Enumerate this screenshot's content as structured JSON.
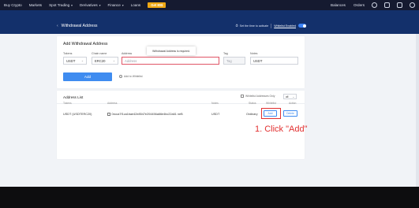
{
  "topnav": {
    "items": [
      {
        "label": "Buy Crypto",
        "caret": false
      },
      {
        "label": "Markets",
        "caret": false
      },
      {
        "label": "Spot Trading",
        "caret": true
      },
      {
        "label": "Derivatives",
        "caret": true
      },
      {
        "label": "Finance",
        "caret": true
      },
      {
        "label": "Loans",
        "caret": false
      }
    ],
    "badge": "Get 80$",
    "balances": "Balances",
    "orders": "Orders",
    "caret_glyph": "▾"
  },
  "subheader": {
    "back_glyph": "‹",
    "title": "Withdrawal Address",
    "time_link": "Set the time to activate",
    "whitelist_label": "Whitelist Enabled",
    "whitelist_enabled": true
  },
  "add_form": {
    "title": "Add Withdrawal Address",
    "token_label": "Tokens",
    "token_value": "USDT",
    "chain_label": "Chain name",
    "chain_value": "ERC20",
    "address_label": "Address",
    "address_placeholder": "Address",
    "tag_label": "Tag",
    "tag_placeholder": "Tag",
    "notes_label": "Notes",
    "notes_value": "USDT",
    "error_tooltip": "Withdrawal Address is required.",
    "add_button": "Add",
    "whitelist_checkbox": "Add to Whitelist",
    "arrow_glyph": "⌄"
  },
  "address_list": {
    "title": "Address List",
    "filter_label": "Whitelist Addresses Only",
    "filter_select": "all",
    "columns": [
      "Tokens",
      "Address",
      "Notes",
      "Status",
      "Whitelist",
      "Action"
    ],
    "rows": [
      {
        "token": "USDT (USDTERC20)",
        "address": "0xcca7f1ca1bae42e8547e204456a66e4bc22a61 neB",
        "notes": "USDT",
        "status": "Ordinary",
        "whitelist_action": "Add",
        "action": "Delete"
      }
    ]
  },
  "annotation": {
    "text": "1. Click \"Add\"",
    "color": "#e23030"
  },
  "colors": {
    "nav_bg": "#151a30",
    "banner_bg": "#13306b",
    "accent": "#3f8cf0",
    "badge": "#f0a814",
    "error": "#e05567"
  }
}
